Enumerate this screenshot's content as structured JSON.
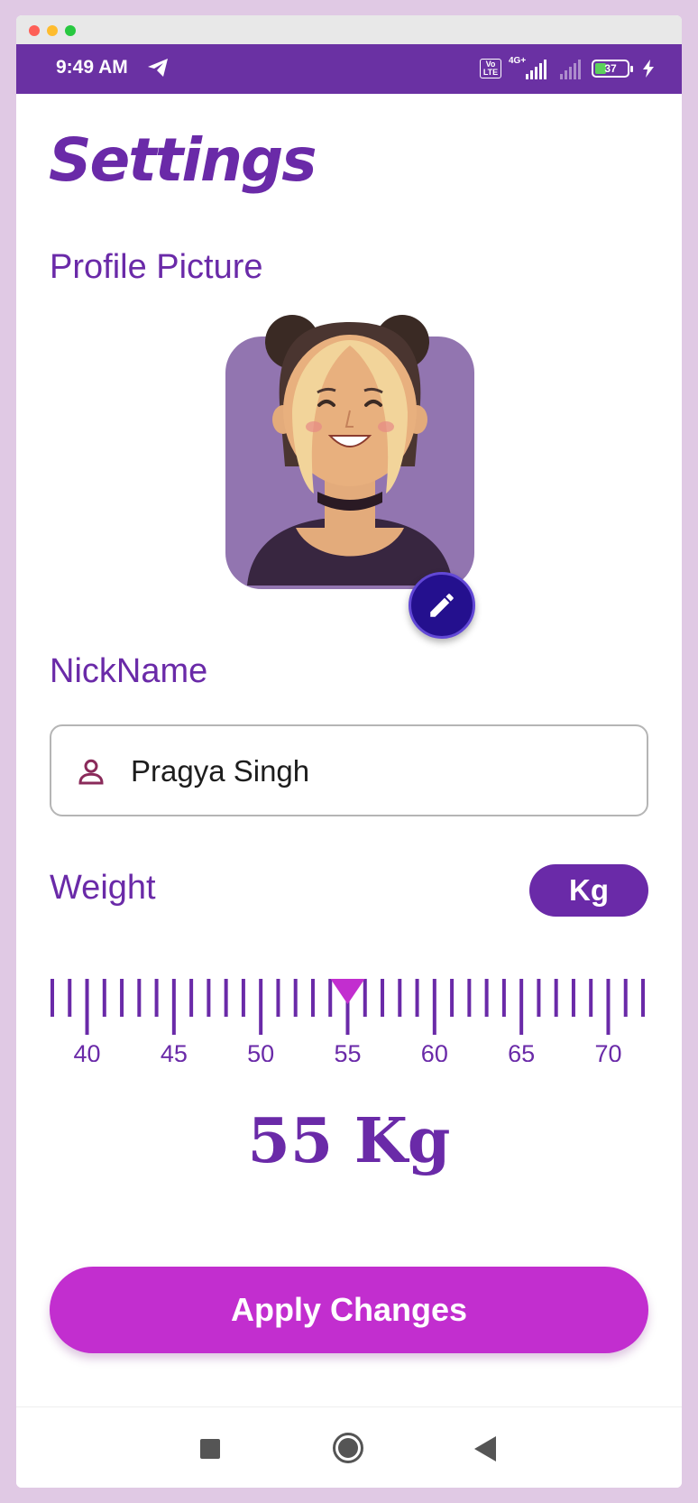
{
  "status_bar": {
    "time": "9:49 AM",
    "volte": "Vo LTE",
    "network": "4G+",
    "battery": "37"
  },
  "page": {
    "title": "Settings"
  },
  "profile": {
    "label": "Profile Picture"
  },
  "nickname": {
    "label": "NickName",
    "value": "Pragya Singh"
  },
  "weight": {
    "label": "Weight",
    "unit": "Kg",
    "ruler_labels": [
      "40",
      "45",
      "50",
      "55",
      "60",
      "65",
      "70"
    ],
    "ruler_min": 38,
    "ruler_max": 72,
    "selected": 55,
    "display": "55 Kg"
  },
  "actions": {
    "apply_label": "Apply Changes"
  },
  "colors": {
    "primary": "#6a2aa8",
    "accent": "#c22ecf",
    "fab": "#24108e",
    "status_bar": "#6a31a3"
  }
}
